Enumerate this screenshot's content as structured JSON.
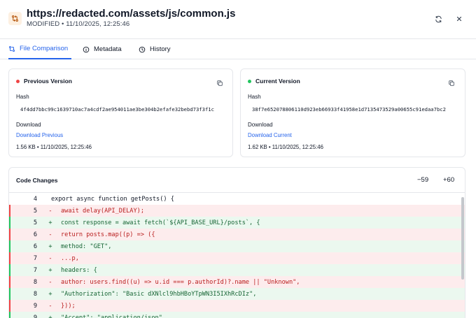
{
  "header": {
    "title": "https://redacted.com/assets/js/common.js",
    "status": "MODIFIED",
    "separator": "•",
    "timestamp": "11/10/2025, 12:25:46"
  },
  "tabs": [
    {
      "label": "File Comparison",
      "icon": "compare-icon",
      "active": true
    },
    {
      "label": "Metadata",
      "icon": "info-icon",
      "active": false
    },
    {
      "label": "History",
      "icon": "clock-icon",
      "active": false
    }
  ],
  "previous": {
    "title": "Previous Version",
    "dot_color": "#ef4444",
    "hash_label": "Hash",
    "hash": "4f4dd7bbc99c1639710ac7a4cdf2ae954011ae3be304b2efafe32bebd73f3f1c",
    "download_label": "Download",
    "download_link": "Download Previous",
    "meta": "1.56 KB • 11/10/2025, 12:25:46"
  },
  "current": {
    "title": "Current Version",
    "dot_color": "#22c55e",
    "hash_label": "Hash",
    "hash": "38f7e652078806110d923eb66933f41958e1d7135473529a00655c91edaa7bc2",
    "download_label": "Download",
    "download_link": "Download Current",
    "meta": "1.62 KB • 11/10/2025, 12:25:46"
  },
  "changes": {
    "title": "Code Changes",
    "removed": "−59",
    "added": "+60",
    "lines": [
      {
        "type": "ctx",
        "num": "4",
        "marker": "",
        "code": "export async function getPosts() {"
      },
      {
        "type": "del",
        "num": "5",
        "marker": "-",
        "code": "await delay(API_DELAY);"
      },
      {
        "type": "add",
        "num": "5",
        "marker": "+",
        "code": "const response = await fetch(`${API_BASE_URL}/posts`, {"
      },
      {
        "type": "del",
        "num": "6",
        "marker": "-",
        "code": "return posts.map((p) => ({"
      },
      {
        "type": "add",
        "num": "6",
        "marker": "+",
        "code": "method: \"GET\","
      },
      {
        "type": "del",
        "num": "7",
        "marker": "-",
        "code": "...p,"
      },
      {
        "type": "add",
        "num": "7",
        "marker": "+",
        "code": "headers: {"
      },
      {
        "type": "del",
        "num": "8",
        "marker": "-",
        "code": "author: users.find((u) => u.id === p.authorId)?.name || \"Unknown\","
      },
      {
        "type": "add",
        "num": "8",
        "marker": "+",
        "code": "\"Authorization\": \"Basic dXNlcl9hbHBoYTpWN3I5IXhRcDIz\","
      },
      {
        "type": "del",
        "num": "9",
        "marker": "-",
        "code": "}));"
      },
      {
        "type": "add",
        "num": "9",
        "marker": "+",
        "code": "\"Accept\": \"application/json\","
      }
    ]
  }
}
